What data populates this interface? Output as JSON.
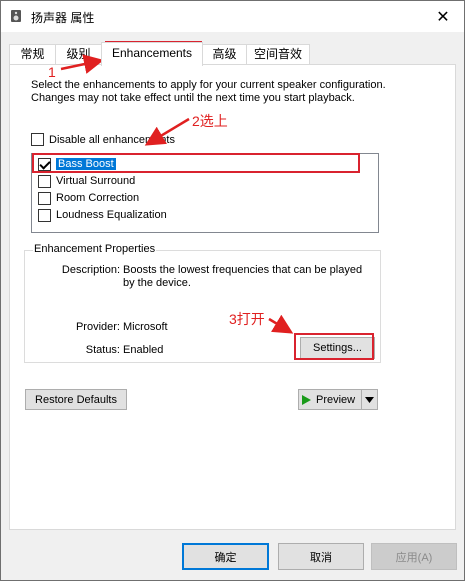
{
  "window": {
    "title": "扬声器 属性",
    "close_glyph": "✕"
  },
  "tabs": [
    {
      "label": "常规"
    },
    {
      "label": "级别"
    },
    {
      "label": "Enhancements"
    },
    {
      "label": "高级"
    },
    {
      "label": "空间音效"
    }
  ],
  "enhancements": {
    "description": "Select the enhancements to apply for your current speaker configuration. Changes may not take effect until the next time you start playback.",
    "disable_all_label": "Disable all enhancements",
    "items": [
      {
        "label": "Bass Boost",
        "checked": true,
        "selected": true
      },
      {
        "label": "Virtual Surround",
        "checked": false
      },
      {
        "label": "Room Correction",
        "checked": false
      },
      {
        "label": "Loudness Equalization",
        "checked": false
      }
    ]
  },
  "properties": {
    "group_title": "Enhancement Properties",
    "description_label": "Description:",
    "description_value": "Boosts the lowest frequencies that can be played by the device.",
    "provider_label": "Provider:",
    "provider_value": "Microsoft",
    "status_label": "Status:",
    "status_value": "Enabled",
    "settings_button": "Settings..."
  },
  "restore_defaults": "Restore Defaults",
  "preview_button": "Preview",
  "footer": {
    "ok": "确定",
    "cancel": "取消",
    "apply": "应用(A)"
  },
  "annotations": {
    "step1": "1",
    "step2": "2选上",
    "step3": "3打开",
    "color": "#e02020"
  }
}
